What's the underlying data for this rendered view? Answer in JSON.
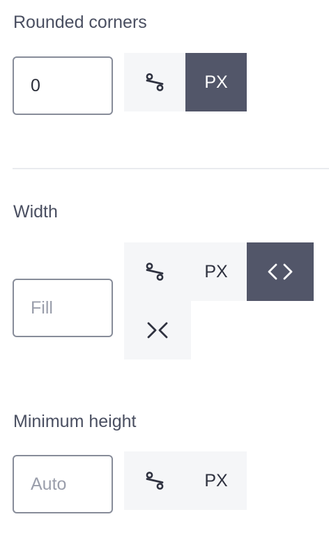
{
  "rounded_corners": {
    "label": "Rounded corners",
    "value": "0",
    "placeholder": "",
    "units": [
      {
        "id": "percent",
        "label": "",
        "icon": "percent-icon",
        "active": false
      },
      {
        "id": "px",
        "label": "PX",
        "icon": "",
        "active": true
      }
    ]
  },
  "width": {
    "label": "Width",
    "value": "",
    "placeholder": "Fill",
    "units": [
      {
        "id": "percent",
        "label": "",
        "icon": "percent-icon",
        "active": false
      },
      {
        "id": "px",
        "label": "PX",
        "icon": "",
        "active": false
      },
      {
        "id": "fill",
        "label": "",
        "icon": "expand-arrows-icon",
        "active": true
      },
      {
        "id": "fit",
        "label": "",
        "icon": "shrink-arrows-icon",
        "active": false
      }
    ]
  },
  "min_height": {
    "label": "Minimum height",
    "value": "",
    "placeholder": "Auto",
    "units": [
      {
        "id": "percent",
        "label": "",
        "icon": "percent-icon",
        "active": false
      },
      {
        "id": "px",
        "label": "PX",
        "icon": "",
        "active": false
      }
    ]
  },
  "colors": {
    "active_bg": "#525669",
    "inactive_bg": "#f5f6f8",
    "label_text": "#4a4f61",
    "input_border": "#878c99"
  }
}
